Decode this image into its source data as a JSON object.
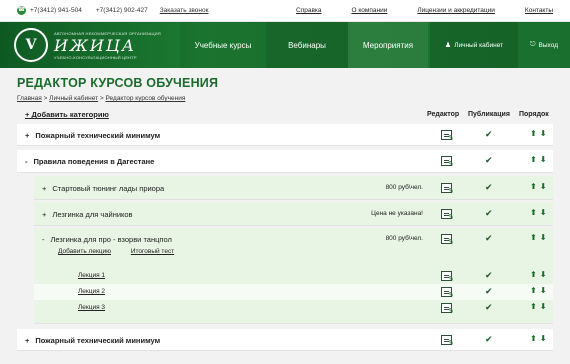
{
  "topbar": {
    "phone1": "+7(3412) 941-504",
    "phone2": "+7(3412) 902-427",
    "callback": "Заказать звонок",
    "links": [
      "Справка",
      "О компании",
      "Лицензии и аккредитации",
      "Контакты"
    ]
  },
  "logo": {
    "line1": "АВТОНОМНАЯ НЕКОММЕРЧЕСКАЯ ОРГАНИЗАЦИЯ",
    "name": "ИЖИЦА",
    "line2": "УЧЕБНО-КОНСУЛЬТАЦИОННЫЙ ЦЕНТР"
  },
  "nav": [
    "Учебные курсы",
    "Вебинары",
    "Мероприятия"
  ],
  "account": {
    "cabinet": "Личный кабинет",
    "logout": "Выход"
  },
  "page": {
    "title": "РЕДАКТОР КУРСОВ ОБУЧЕНИЯ",
    "breadcrumb": [
      "Главная",
      "Личный кабинет",
      "Редактор курсов обучения"
    ],
    "separator": ">",
    "add_category": "+ Добавить категорию",
    "columns": {
      "editor": "Редактор",
      "publish": "Публикация",
      "order": "Порядок"
    }
  },
  "rows": {
    "r1": {
      "pm": "+",
      "label": "Пожарный технический минимум"
    },
    "r2": {
      "pm": "-",
      "label": "Правила поведения в Дагестане"
    },
    "r3": {
      "pm": "+",
      "label": "Стартовый тюнинг лады приора",
      "price": "800 руб\\чел."
    },
    "r4": {
      "pm": "+",
      "label": "Лезгинка для чайников",
      "price": "Цена не указана!"
    },
    "r5": {
      "pm": "-",
      "label": "Лезгинка для про - взорви танцпол",
      "price": "800 руб\\чел.",
      "add_lesson": "Добавить лекцию",
      "final_test": "Итоговый тест"
    },
    "lessons": [
      "Лекция 1",
      "Лекция 2",
      "Лекция 3"
    ],
    "r6": {
      "pm": "+",
      "label": "Пожарный технический минимум"
    }
  },
  "icons": {
    "check": "✔",
    "up": "⬆",
    "down": "⬇",
    "phone": "☎",
    "user": "user-icon",
    "exit": "exit-icon"
  },
  "colors": {
    "brand_green": "#1a6f2e",
    "title_green": "#1b6b2c",
    "row_green": "#e8f4e4"
  }
}
